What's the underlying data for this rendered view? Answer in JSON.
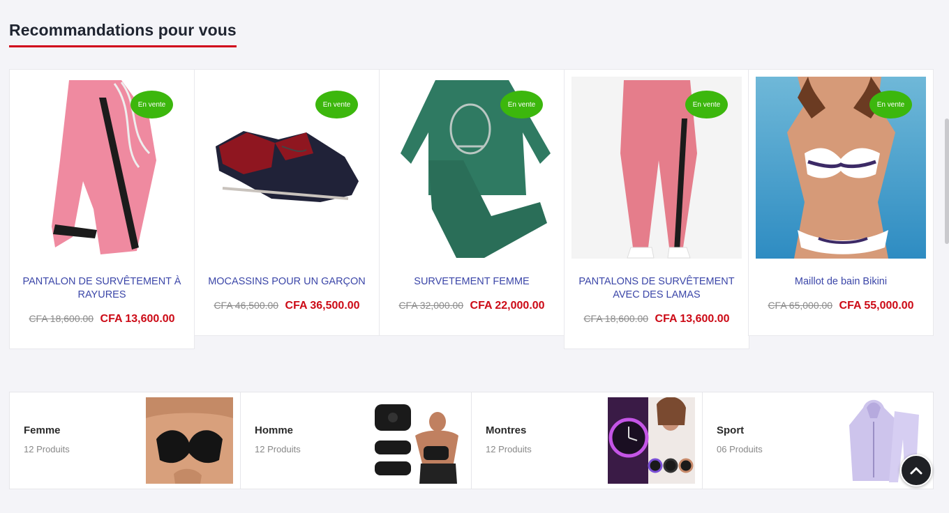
{
  "section": {
    "title": "Recommandations pour vous"
  },
  "products": [
    {
      "name": "PANTALON DE SURVÊTEMENT À RAYURES",
      "badge": "En vente",
      "old_price": "CFA 18,600.00",
      "new_price": "CFA 13,600.00",
      "image": "pink-track-pants"
    },
    {
      "name": "MOCASSINS POUR UN GARÇON",
      "badge": "En vente",
      "old_price": "CFA 46,500.00",
      "new_price": "CFA 36,500.00",
      "image": "boys-moccasins"
    },
    {
      "name": "SURVETEMENT FEMME",
      "badge": "En vente",
      "old_price": "CFA 32,000.00",
      "new_price": "CFA 22,000.00",
      "image": "green-tracksuit"
    },
    {
      "name": "PANTALONS DE SURVÊTEMENT AVEC DES LAMAS",
      "badge": "En vente",
      "old_price": "CFA 18,600.00",
      "new_price": "CFA 13,600.00",
      "image": "pink-sweatpants-model"
    },
    {
      "name": "Maillot de bain Bikini",
      "badge": "En vente",
      "old_price": "CFA 65,000.00",
      "new_price": "CFA 55,000.00",
      "image": "bikini-model"
    }
  ],
  "categories": [
    {
      "name": "Femme",
      "count": "12 Produits",
      "image": "bra-photo"
    },
    {
      "name": "Homme",
      "count": "12 Produits",
      "image": "ems-trainer-photo"
    },
    {
      "name": "Montres",
      "count": "12 Produits",
      "image": "watches-photo"
    },
    {
      "name": "Sport",
      "count": "06 Produits",
      "image": "sport-tracksuit-photo"
    }
  ],
  "colors": {
    "accent": "#d0021b",
    "price": "#cc0a16",
    "badge": "#3cb70d",
    "link": "#3b46a8"
  },
  "icons": {
    "scroll_top": "chevron-up-icon"
  }
}
